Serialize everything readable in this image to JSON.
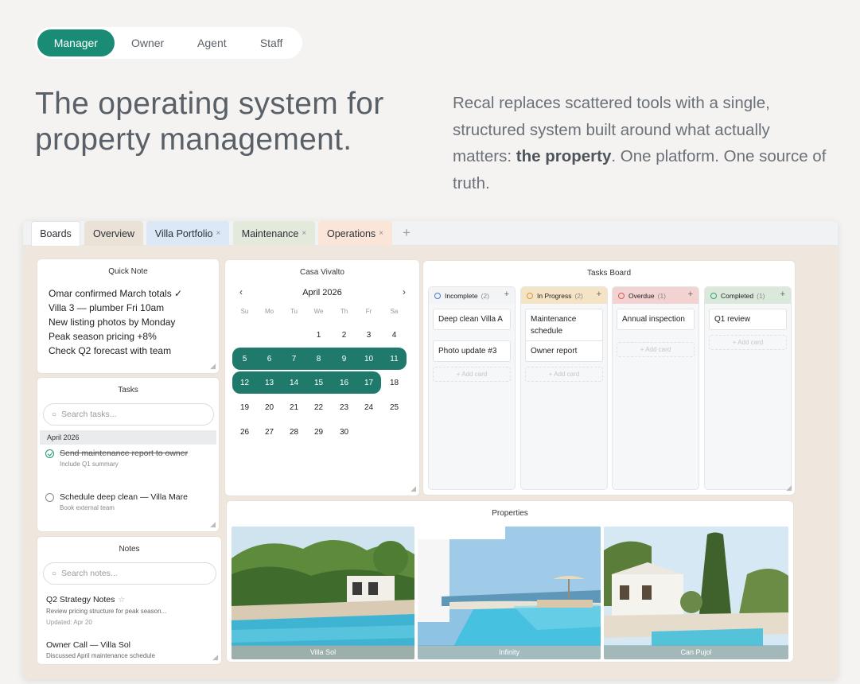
{
  "roles": [
    "Manager",
    "Owner",
    "Agent",
    "Staff"
  ],
  "headline": "The operating system for property management.",
  "lede": {
    "before": "Recal replaces scattered tools with a single, structured system built around what actually matters: ",
    "bold": "the property",
    "after": ". One platform. One source of truth."
  },
  "tabs": {
    "boards": "Boards",
    "overview": "Overview",
    "villa": "Villa Portfolio",
    "maintenance": "Maintenance",
    "operations": "Operations",
    "close": "×",
    "add": "+"
  },
  "quick_note": {
    "title": "Quick Note",
    "lines": [
      "Omar confirmed March totals ✓",
      "Villa 3 — plumber Fri 10am",
      "New listing photos by Monday",
      "Peak season pricing +8%",
      "Check Q2 forecast with team"
    ]
  },
  "tasks": {
    "title": "Tasks",
    "search_placeholder": "Search tasks...",
    "month": "April 2026",
    "items": [
      {
        "title": "Send maintenance report to owner",
        "sub": "Include Q1 summary"
      },
      {
        "title": "Schedule deep clean — Villa Mare",
        "sub": "Book external team"
      }
    ]
  },
  "notes": {
    "title": "Notes",
    "search_placeholder": "Search notes...",
    "items": [
      {
        "title": "Q2 Strategy Notes",
        "sub": "Review pricing structure for peak season...",
        "date": "Updated: Apr 20"
      },
      {
        "title": "Owner Call — Villa Sol",
        "sub": "Discussed April maintenance schedule"
      }
    ]
  },
  "calendar": {
    "title": "Casa Vivalto",
    "month": "April 2026",
    "prev": "‹",
    "next": "›",
    "dow": [
      "Su",
      "Mo",
      "Tu",
      "We",
      "Th",
      "Fr",
      "Sa"
    ],
    "selected_from": 5,
    "selected_to": 17
  },
  "board": {
    "title": "Tasks Board",
    "add_label": "+ Add card",
    "plus": "+",
    "columns": [
      {
        "name": "Incomplete",
        "count": "(2)",
        "color": "#4a78c9",
        "head_bg": "#f3f4f6",
        "cards": [
          "Deep clean Villa A",
          "Photo update #3"
        ]
      },
      {
        "name": "In Progress",
        "count": "(2)",
        "color": "#d29a3a",
        "head_bg": "#f5e3c6",
        "cards": [
          "Maintenance schedule",
          "Owner report"
        ]
      },
      {
        "name": "Overdue",
        "count": "(1)",
        "color": "#d45a5a",
        "head_bg": "#f3d2d2",
        "cards": [
          "Annual inspection"
        ]
      },
      {
        "name": "Completed",
        "count": "(1)",
        "color": "#3aa56f",
        "head_bg": "#dbe8dc",
        "cards": [
          "Q1 review"
        ]
      }
    ]
  },
  "properties": {
    "title": "Properties",
    "items": [
      "Villa Sol",
      "Infinity",
      "Can Pujol"
    ]
  },
  "colors": {
    "accent": "#1a8c76",
    "calendar_selected": "#1f7a6c"
  }
}
